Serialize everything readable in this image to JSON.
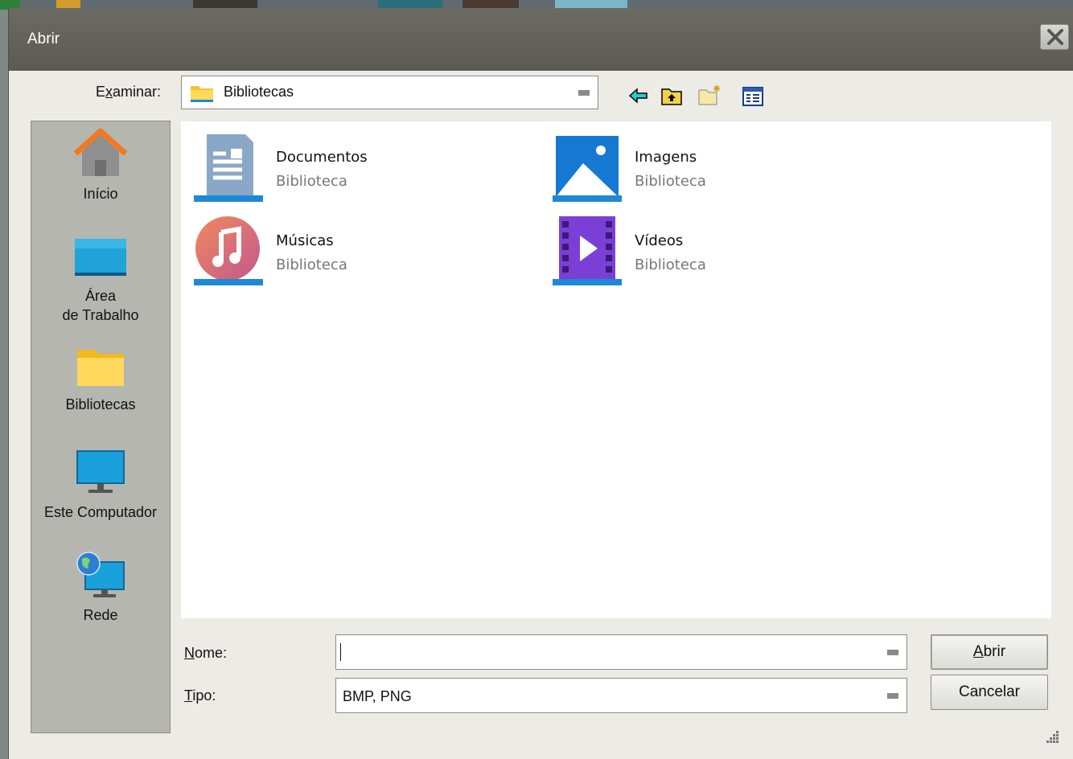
{
  "window": {
    "title": "Abrir"
  },
  "toolbar": {
    "look_in_label": "Examinar:",
    "look_in_value": "Bibliotecas",
    "back_icon": "back-arrow-icon",
    "up_icon": "up-folder-icon",
    "new_folder_icon": "new-folder-icon",
    "view_menu_icon": "view-menu-icon"
  },
  "places": [
    {
      "label": "Início",
      "icon": "home-icon"
    },
    {
      "label": "Área",
      "label2": "de Trabalho",
      "icon": "desktop-icon"
    },
    {
      "label": "Bibliotecas",
      "icon": "folder-icon"
    },
    {
      "label": "Este Computador",
      "icon": "computer-icon"
    },
    {
      "label": "Rede",
      "icon": "network-icon"
    }
  ],
  "libraries": [
    {
      "name": "Documentos",
      "type": "Biblioteca",
      "icon": "documents-library-icon"
    },
    {
      "name": "Imagens",
      "type": "Biblioteca",
      "icon": "pictures-library-icon"
    },
    {
      "name": "Músicas",
      "type": "Biblioteca",
      "icon": "music-library-icon"
    },
    {
      "name": "Vídeos",
      "type": "Biblioteca",
      "icon": "videos-library-icon"
    }
  ],
  "form": {
    "name_label": "Nome:",
    "name_value": "",
    "type_label": "Tipo:",
    "type_value": "BMP, PNG"
  },
  "buttons": {
    "open": "Abrir",
    "cancel": "Cancelar"
  },
  "colors": {
    "titlebar": "#5b5b54",
    "dialog_bg": "#ecebe5",
    "places_bg": "#b6b6b0",
    "accent_blue": "#1e88d6"
  }
}
